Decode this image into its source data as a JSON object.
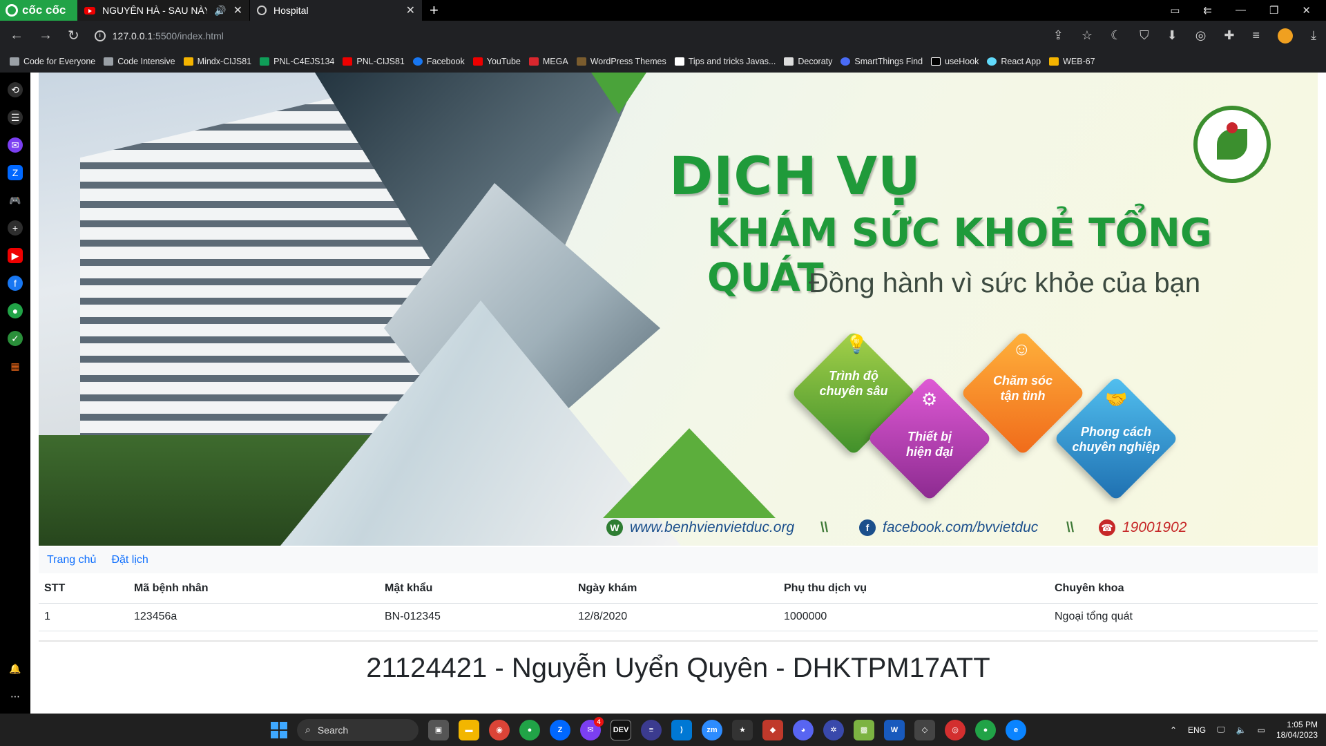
{
  "browser": {
    "brand": "cốc cốc",
    "tabs": [
      {
        "title": "NGUYÊN HÀ - SAU NÀY I",
        "icon": "youtube-icon",
        "audio": true
      },
      {
        "title": "Hospital",
        "icon": "globe-icon",
        "active": true
      }
    ],
    "url_host": "127.0.0.1",
    "url_path": ":5500/index.html",
    "bookmarks": [
      "Code for Everyone",
      "Code Intensive",
      "Mindx-CIJS81",
      "PNL-C4EJS134",
      "PNL-CIJS81",
      "Facebook",
      "YouTube",
      "MEGA",
      "WordPress Themes",
      "Tips and tricks Javas...",
      "Decoraty",
      "SmartThings Find",
      "useHook",
      "React App",
      "WEB-67"
    ]
  },
  "banner": {
    "title_line1": "DỊCH VỤ",
    "title_line2": "KHÁM SỨC KHOẺ TỔNG QUÁT",
    "subtitle": "Đồng hành vì sức khỏe của bạn",
    "features": [
      {
        "line1": "Trình độ",
        "line2": "chuyên sâu",
        "color": "#6cb33f"
      },
      {
        "line1": "Thiết bị",
        "line2": "hiện đại",
        "color": "#b23eae"
      },
      {
        "line1": "Chăm sóc",
        "line2": "tận tình",
        "color": "#f7941d"
      },
      {
        "line1": "Phong cách",
        "line2": "chuyên nghiệp",
        "color": "#2a8fd3"
      }
    ],
    "website": "www.benhvienvietduc.org",
    "facebook": "facebook.com/bvvietduc",
    "separator": "\\\\",
    "hotline": "19001902"
  },
  "nav": {
    "home": "Trang chủ",
    "booking": "Đặt lịch"
  },
  "table": {
    "headers": [
      "STT",
      "Mã bệnh nhân",
      "Mật khẩu",
      "Ngày khám",
      "Phụ thu dịch vụ",
      "Chuyên khoa"
    ],
    "rows": [
      [
        "1",
        "123456a",
        "BN-012345",
        "12/8/2020",
        "1000000",
        "Ngoại tổng quát"
      ]
    ]
  },
  "student_line": "21124421 - Nguyễn Uyển Quyên - DHKTPM17ATT",
  "taskbar": {
    "search": "Search",
    "lang": "ENG",
    "time": "1:05 PM",
    "date": "18/04/2023",
    "messenger_badge": "4"
  }
}
